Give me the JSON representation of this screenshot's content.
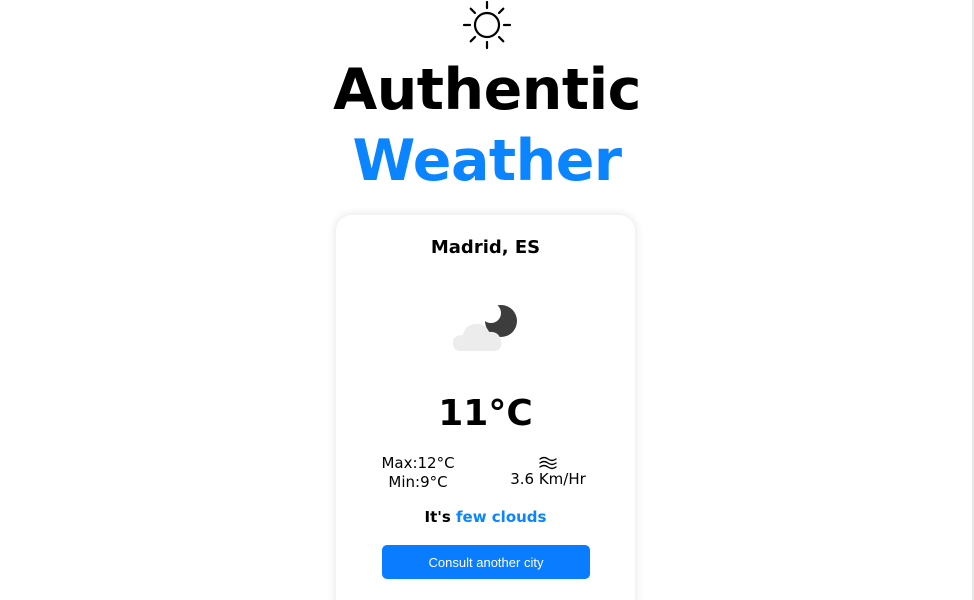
{
  "header": {
    "icon": "sun-icon",
    "title_line1": "Authentic",
    "title_line2": "Weather",
    "accent_color": "#0a84ff"
  },
  "card": {
    "city": "Madrid, ES",
    "condition_icon": "cloud-moon-icon",
    "temperature": "11°C",
    "max": "Max:12°C",
    "min": "Min:9°C",
    "wind_icon": "wind-icon",
    "wind_speed": "3.6 Km/Hr",
    "description_prefix": "It's",
    "description": "few clouds",
    "button_label": "Consult another city"
  }
}
